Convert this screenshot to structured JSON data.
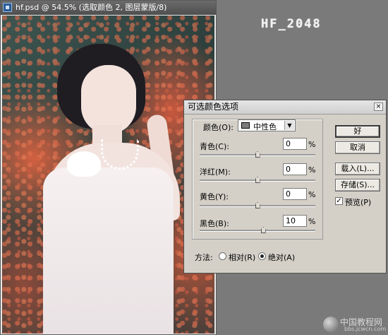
{
  "document": {
    "title": "hf.psd @ 54.5% (选取颜色 2, 图层蒙版/8)"
  },
  "watermark": {
    "text": "HF_2048"
  },
  "dialog": {
    "title": "可选颜色选项",
    "close_glyph": "×",
    "colors_label": "颜色(O):",
    "colors_value": "中性色",
    "sliders": [
      {
        "label": "青色(C):",
        "value": "0",
        "unit": "%",
        "level_percent": 0
      },
      {
        "label": "洋红(M):",
        "value": "0",
        "unit": "%",
        "level_percent": 0
      },
      {
        "label": "黄色(Y):",
        "value": "0",
        "unit": "%",
        "level_percent": 0
      },
      {
        "label": "黑色(B):",
        "value": "10",
        "unit": "%",
        "level_percent": 10
      }
    ],
    "buttons": {
      "ok": "好",
      "cancel": "取消",
      "load": "载入(L)...",
      "save": "存储(S)..."
    },
    "preview_label": "预览(P)",
    "preview_checked": true,
    "method_label": "方法:",
    "method_options": [
      {
        "label": "相对(R)",
        "selected": false
      },
      {
        "label": "绝对(A)",
        "selected": true
      }
    ]
  },
  "site_logo": {
    "name": "中国教程网",
    "url": "bbs.jcwcn.com"
  },
  "colors": {
    "workspace": "#7a7a7a",
    "dialog_bg": "#d4d0c8"
  }
}
